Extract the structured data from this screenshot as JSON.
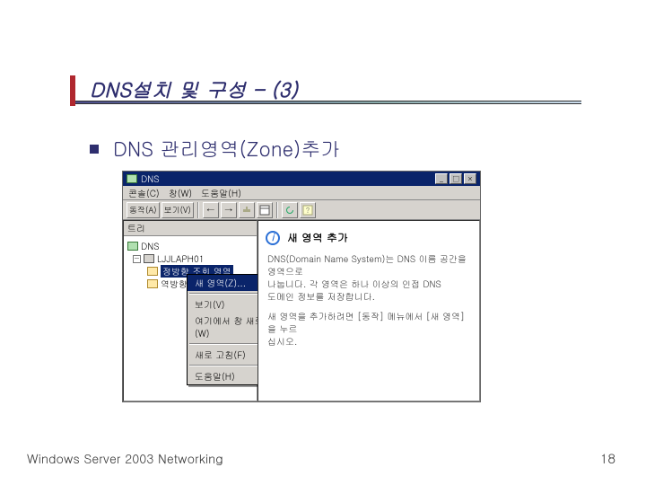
{
  "slide": {
    "title": "DNS설치 및 구성 – (3)",
    "bullet": "DNS 관리영역(Zone)추가",
    "footer": "Windows  Server 2003 Networking",
    "page": "18"
  },
  "window": {
    "title": "DNS",
    "controls": {
      "min": "_",
      "max": "□",
      "close": "×"
    },
    "menubar": [
      "콘솔(C)",
      "창(W)",
      "도움말(H)"
    ],
    "toolbar": {
      "action": "동작(A)",
      "view": "보기(V)",
      "back": "←",
      "fwd": "→",
      "up_icon": "up-icon",
      "props_icon": "props-icon",
      "refresh_icon": "refresh-icon",
      "help_icon": "help-icon"
    },
    "tree": {
      "header": "트리",
      "root": "DNS",
      "server": "LJJLAPH01",
      "fwd_zone": "정방향 조회 영역",
      "rev_zone": "역방향 조회 영역"
    },
    "context_menu": {
      "new_zone": "새 영역(Z)...",
      "view": "보기(V)",
      "new_window": "여기에서 창 새로 만들기(W)",
      "refresh": "새로 고침(F)",
      "help": "도움말(H)"
    },
    "info": {
      "title": "새 영역 추가",
      "line1": "DNS(Domain Name System)는 DNS 이름 공간을 영역으로",
      "line2": "나눕니다. 각 영역은 하나 이상의 인접 DNS",
      "line3": "도메인 정보를 저장합니다.",
      "line4": "새 영역을 추가하려면 [동작] 메뉴에서 [새 영역]을 누르",
      "line5": "십시오."
    }
  }
}
